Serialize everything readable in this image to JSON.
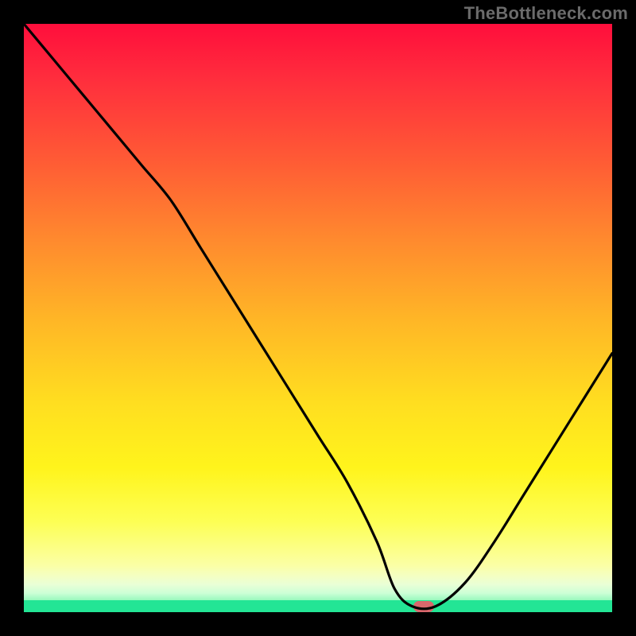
{
  "watermark": "TheBottleneck.com",
  "colors": {
    "background": "#000000",
    "watermark_text": "#6b6b6b",
    "curve_stroke": "#000000",
    "marker": "#d9676c",
    "gradient_top": "#ff0e3c",
    "gradient_mid": "#ffde20",
    "gradient_bottom_band": "#23e595"
  },
  "chart_data": {
    "type": "line",
    "title": "",
    "xlabel": "",
    "ylabel": "",
    "xlim": [
      0,
      100
    ],
    "ylim": [
      0,
      100
    ],
    "grid": false,
    "legend": false,
    "x": [
      0,
      5,
      10,
      15,
      20,
      25,
      30,
      35,
      40,
      45,
      50,
      55,
      60,
      63,
      66,
      70,
      75,
      80,
      85,
      90,
      95,
      100
    ],
    "values": [
      100,
      94,
      88,
      82,
      76,
      70,
      62,
      54,
      46,
      38,
      30,
      22,
      12,
      4,
      1,
      1,
      5,
      12,
      20,
      28,
      36,
      44
    ],
    "marker": {
      "x": 68,
      "y": 1
    },
    "notes": "Values estimated from pixels; y=0 is the bottom green band, y=100 is the red top. Curve descends from top-left, flattens briefly near the bottom around x≈63–70, then rises toward the right edge."
  }
}
